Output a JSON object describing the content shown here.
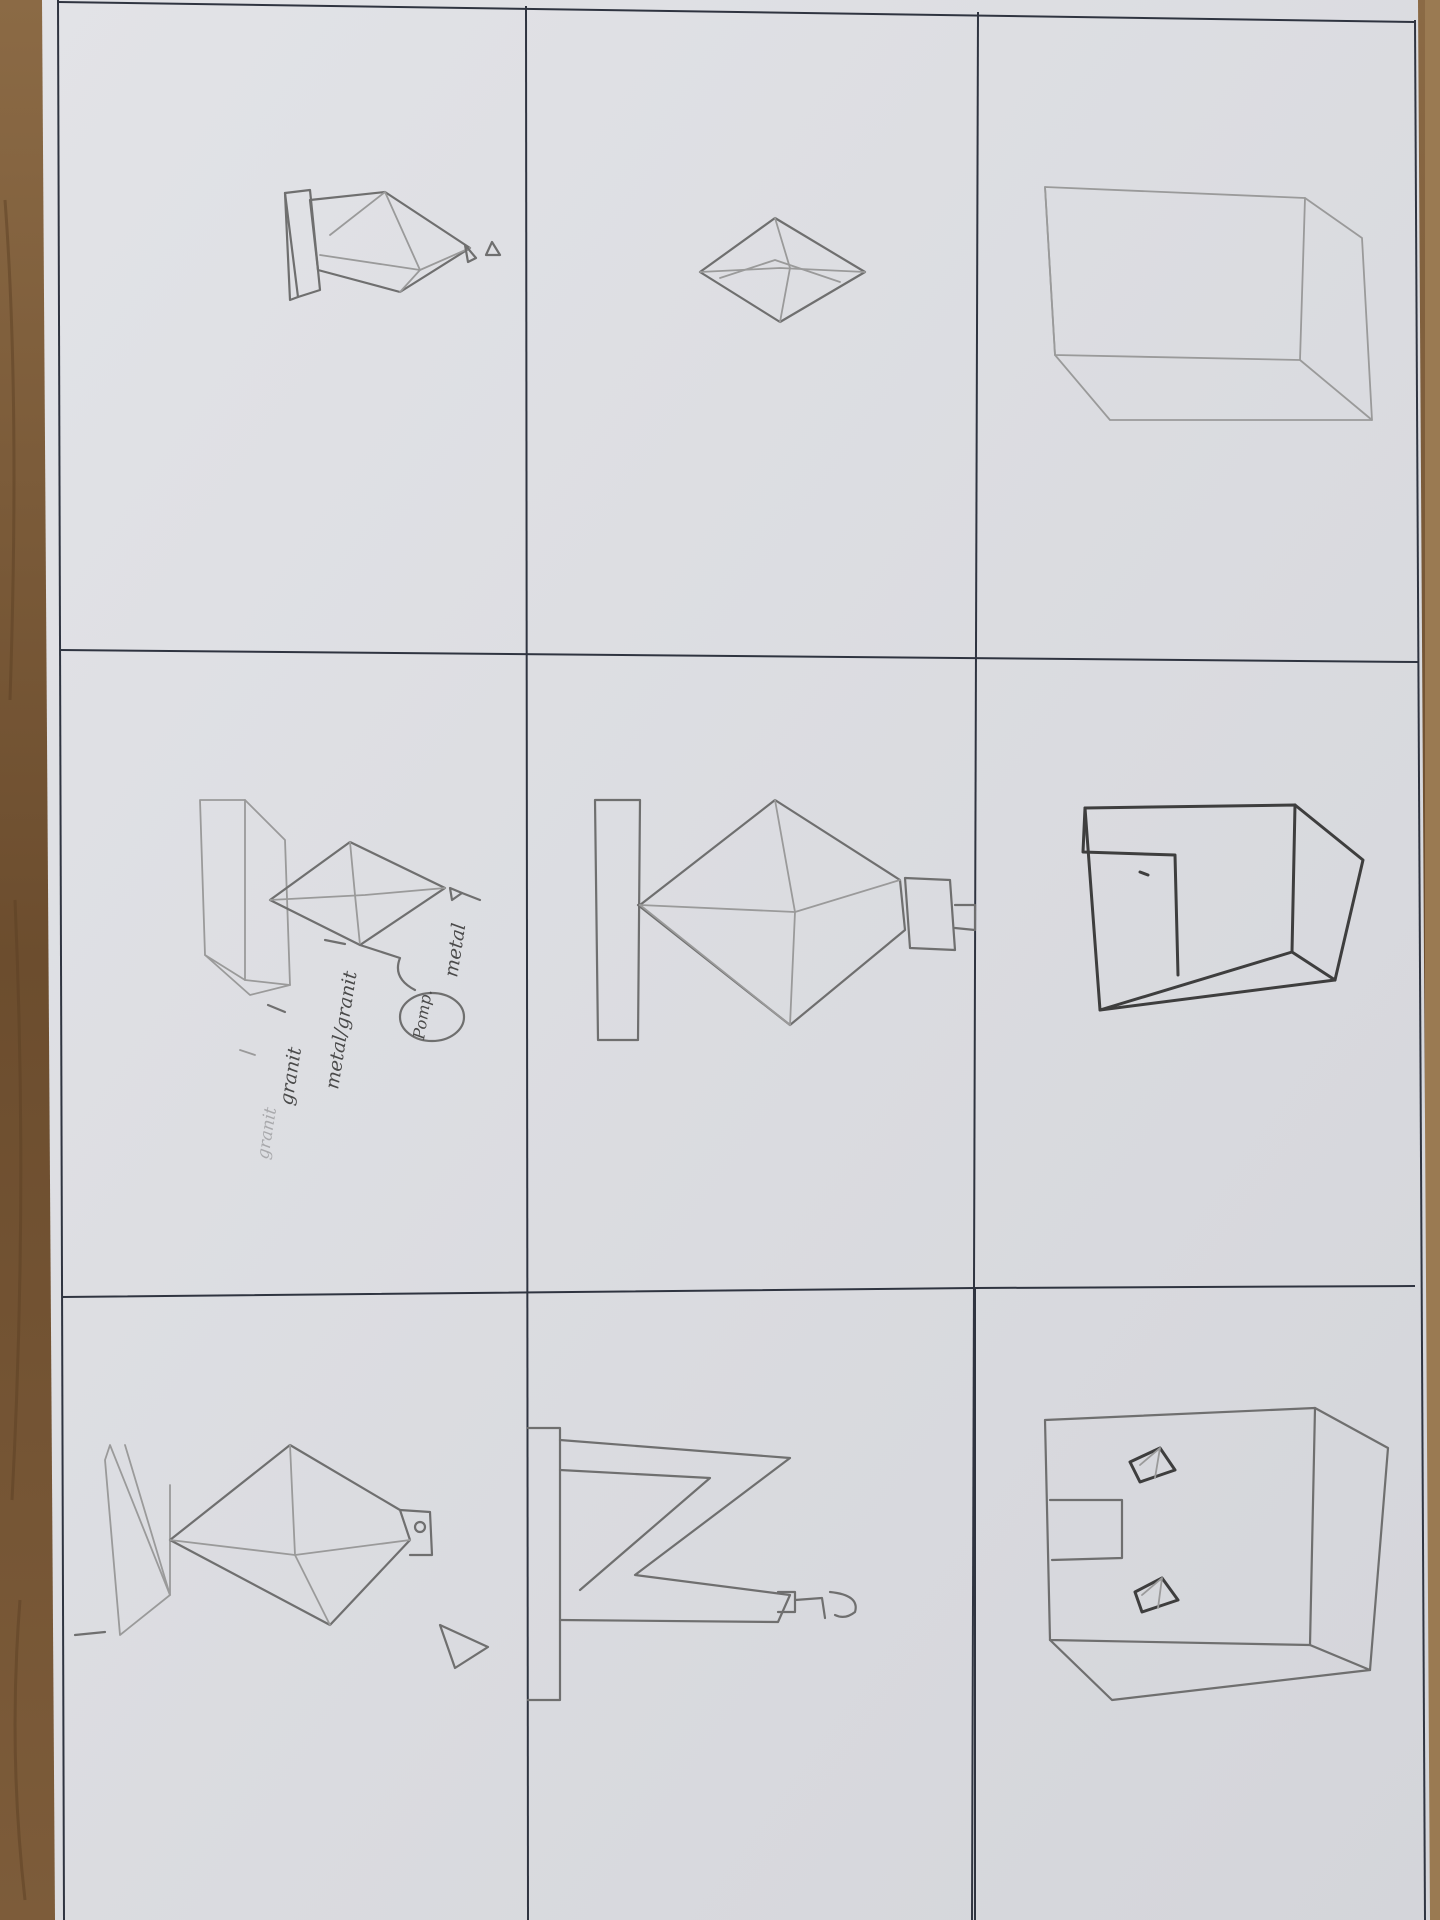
{
  "colors": {
    "desk": "#7a5a38",
    "paper": "#dcdde1",
    "grid_line": "#2f3440",
    "pencil": "#6f6f6f"
  },
  "annotations": {
    "top": "metal",
    "middle": "metal/granit",
    "lower": "granit",
    "faded": "granit",
    "bubble": "Pomp."
  }
}
